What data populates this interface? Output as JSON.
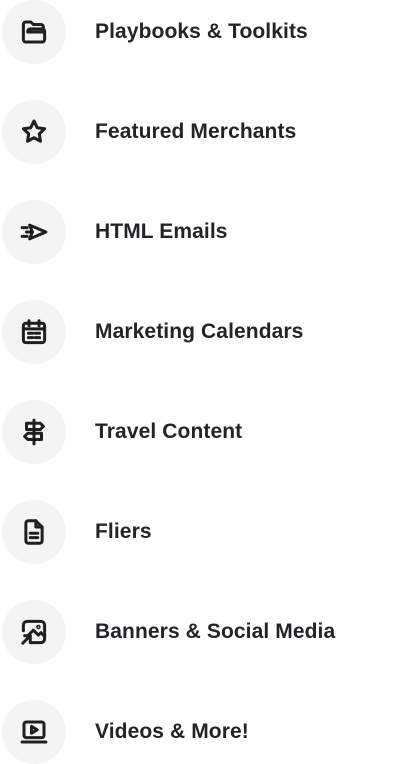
{
  "menu": {
    "items": [
      {
        "label": "Playbooks & Toolkits",
        "icon": "folder-icon"
      },
      {
        "label": "Featured Merchants",
        "icon": "star-icon"
      },
      {
        "label": "HTML Emails",
        "icon": "paper-plane-icon"
      },
      {
        "label": "Marketing Calendars",
        "icon": "calendar-icon"
      },
      {
        "label": "Travel Content",
        "icon": "signpost-icon"
      },
      {
        "label": "Fliers",
        "icon": "document-icon"
      },
      {
        "label": "Banners & Social Media",
        "icon": "image-share-icon"
      },
      {
        "label": "Videos & More!",
        "icon": "video-player-icon"
      }
    ]
  },
  "colors": {
    "text": "#222428",
    "icon": "#1f1f1f",
    "icon_background": "#f4f4f4",
    "page_background": "#ffffff"
  }
}
